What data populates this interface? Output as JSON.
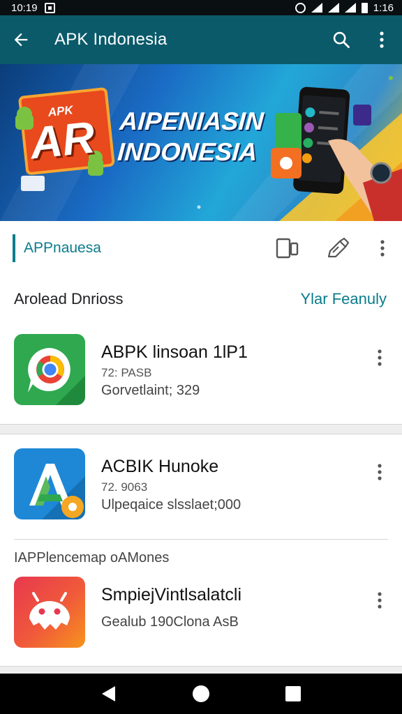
{
  "status_bar": {
    "time": "10:19",
    "clock_right": "1:16"
  },
  "app_bar": {
    "title": "APK Indonesia",
    "icons": [
      "back-arrow-icon",
      "search-icon",
      "more-vert-icon"
    ]
  },
  "banner": {
    "headline_line1": "AIPENIASIN",
    "headline_line2": "INDONESIA",
    "logo_small": "APK",
    "logo_big": "AR"
  },
  "section": {
    "label": "APPnauesa",
    "icons": [
      "device-icon",
      "share-pen-icon",
      "more-vert-icon"
    ]
  },
  "sub_header": {
    "left": "Arolead Dnrioss",
    "right": "Ylar Feanuly"
  },
  "apps": [
    {
      "name": "ABPK linsoan 1lP1",
      "meta1": "72: PASB",
      "meta2": "Gorvetlaint; 329",
      "icon": "chrome-like-app-icon",
      "colors": {
        "bg": "#2fa84f",
        "accent": "#e84336"
      }
    },
    {
      "name": "ACBIK Hunoke",
      "meta1": "72. 9063",
      "meta2": "Ulpeqaice slsslaet;000",
      "icon": "letter-a-app-icon",
      "colors": {
        "bg": "#1e88d6",
        "accent": "#f5a623"
      }
    },
    {
      "name": "SmpiejVintlsalatcli",
      "meta1": "",
      "meta2": "Gealub 190Clona AsB",
      "icon": "android-app-icon",
      "colors": {
        "bg": "#e8384f",
        "accent": "#f7941d"
      }
    }
  ],
  "group_title": "IAPPlencemap oAMones",
  "nav_bar": {
    "icons": [
      "back-triangle-icon",
      "home-circle-icon",
      "recents-square-icon"
    ]
  }
}
